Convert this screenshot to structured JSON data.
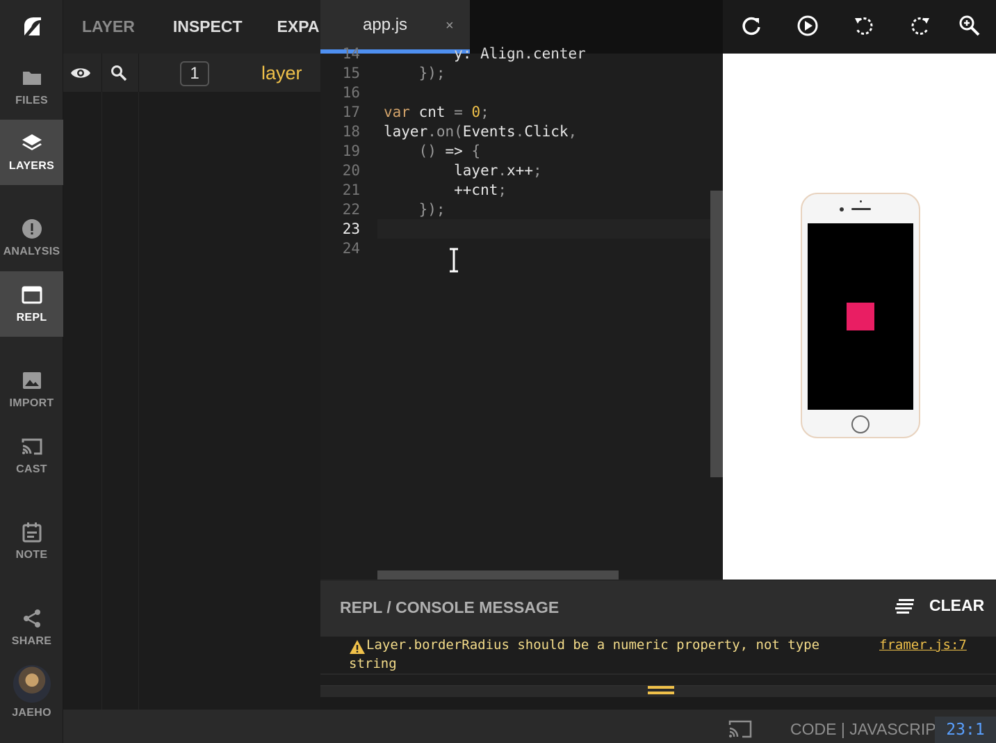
{
  "nav": {
    "items": [
      {
        "label": "FILES",
        "icon": "folder-icon"
      },
      {
        "label": "LAYERS",
        "icon": "layers-icon",
        "active": true
      },
      {
        "label": "ANALYSIS",
        "icon": "alert-icon"
      },
      {
        "label": "REPL",
        "icon": "window-icon"
      },
      {
        "label": "IMPORT",
        "icon": "image-icon"
      },
      {
        "label": "CAST",
        "icon": "cast-icon"
      },
      {
        "label": "NOTE",
        "icon": "calendar-icon"
      },
      {
        "label": "SHARE",
        "icon": "share-icon"
      },
      {
        "label": "JAEHO",
        "icon": "avatar"
      }
    ]
  },
  "layer_panel": {
    "tabs": [
      "LAYER",
      "INSPECT",
      "EXPANI"
    ],
    "count": "1",
    "layer_name": "layer"
  },
  "editor": {
    "tab_label": "app.js",
    "tab_close": "×",
    "lines": [
      {
        "n": "14",
        "text": "        y: Align.center"
      },
      {
        "n": "15",
        "text": "    });"
      },
      {
        "n": "16",
        "text": ""
      },
      {
        "n": "17",
        "text": "var cnt = 0;"
      },
      {
        "n": "18",
        "text": "layer.on(Events.Click,"
      },
      {
        "n": "19",
        "text": "    () => {"
      },
      {
        "n": "20",
        "text": "        layer.x++;"
      },
      {
        "n": "21",
        "text": "        ++cnt;"
      },
      {
        "n": "22",
        "text": "    });"
      },
      {
        "n": "23",
        "text": ""
      },
      {
        "n": "24",
        "text": ""
      }
    ]
  },
  "preview": {
    "toolbar_icons": [
      "refresh-icon",
      "play-icon",
      "rotate-left-icon",
      "rotate-right-icon",
      "zoom-in-icon"
    ],
    "square_color": "#e91e63"
  },
  "console": {
    "title": "REPL / CONSOLE MESSAGE",
    "clear_label": "CLEAR",
    "message_line1": "Layer.borderRadius should be a numeric property, not type",
    "message_line2": "string",
    "source": "framer.js:7"
  },
  "status": {
    "mode": "CODE | JAVASCRIPT",
    "cursor": "23:1"
  }
}
